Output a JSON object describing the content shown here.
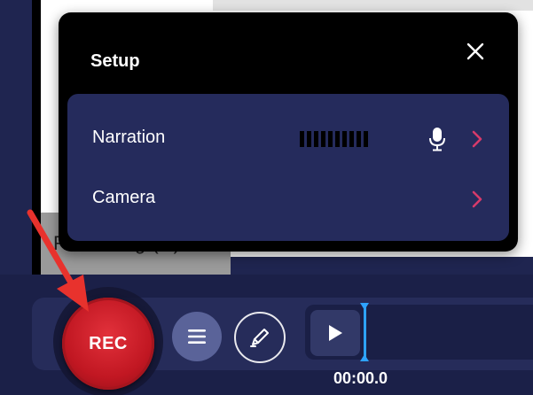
{
  "background": {
    "obscured_text": "Recording (R)"
  },
  "setup_dialog": {
    "title": "Setup",
    "rows": [
      {
        "label": "Narration",
        "level_meter_bars": 10
      },
      {
        "label": "Camera"
      }
    ]
  },
  "toolbar": {
    "record_label": "REC",
    "timecode": "00:00.0"
  },
  "icons": {
    "close": "close-icon",
    "microphone": "microphone-icon",
    "chevron": "chevron-right-icon",
    "menu": "hamburger-menu-icon",
    "draw": "pen-draw-icon",
    "play": "play-icon"
  },
  "colors": {
    "accent_red": "#c11722",
    "chevron_pink": "#d63a6a",
    "playhead_blue": "#2ea3ff",
    "panel_navy": "#252b5c"
  }
}
